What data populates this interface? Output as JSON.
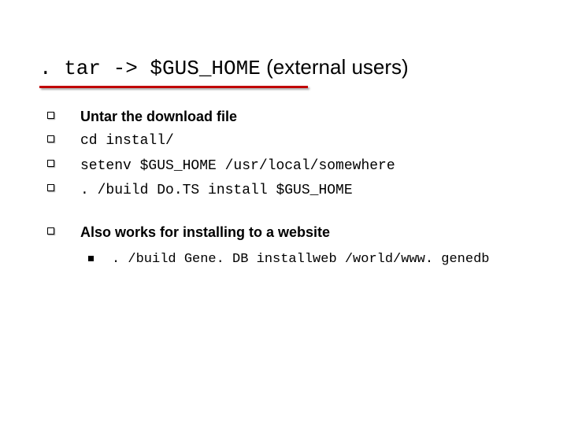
{
  "title_mono": ". tar -> $GUS_HOME",
  "title_rest": " (external users)",
  "items": [
    {
      "text": "Untar the download file",
      "bold": true,
      "mono": false
    },
    {
      "text": "cd install/",
      "bold": false,
      "mono": true
    },
    {
      "text": "setenv $GUS_HOME /usr/local/somewhere",
      "bold": false,
      "mono": true
    },
    {
      "text": ". /build Do.TS install $GUS_HOME",
      "bold": false,
      "mono": true
    }
  ],
  "second_heading": "Also works for installing to a website",
  "sub_items": [
    {
      "text": ". /build Gene. DB installweb /world/www. genedb",
      "mono": true
    }
  ]
}
